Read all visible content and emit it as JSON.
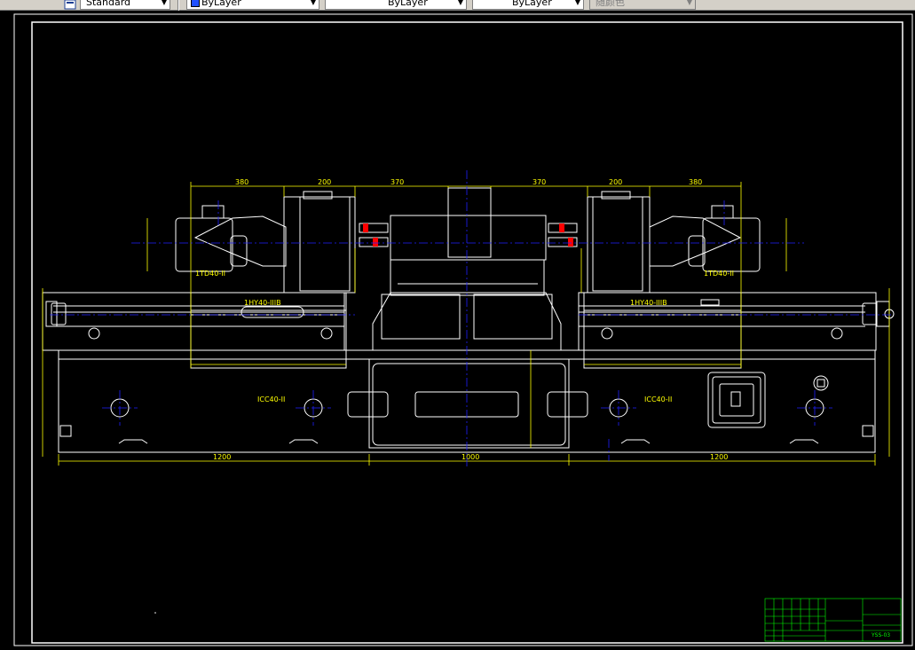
{
  "toolbar": {
    "text_style": "Standard",
    "color": "ByLayer",
    "linetype": "ByLayer",
    "lineweight": "ByLayer",
    "plot_style": "随颜色"
  },
  "drawing": {
    "labels": {
      "left_head": "1TD40-II",
      "right_head": "1TD40-II",
      "left_slide": "1HY40-IIIB",
      "right_slide": "1HY40-IIIB",
      "left_base": "ICC40-II",
      "right_base": "ICC40-II"
    },
    "title_block": {
      "drawing_number": "YSS-03"
    }
  },
  "colors": {
    "background": "#000000",
    "frame": "#ffffff",
    "dimension": "#ffff00",
    "centerline": "#0000ff",
    "title_block": "#00ff00",
    "accent": "#ff0000"
  }
}
